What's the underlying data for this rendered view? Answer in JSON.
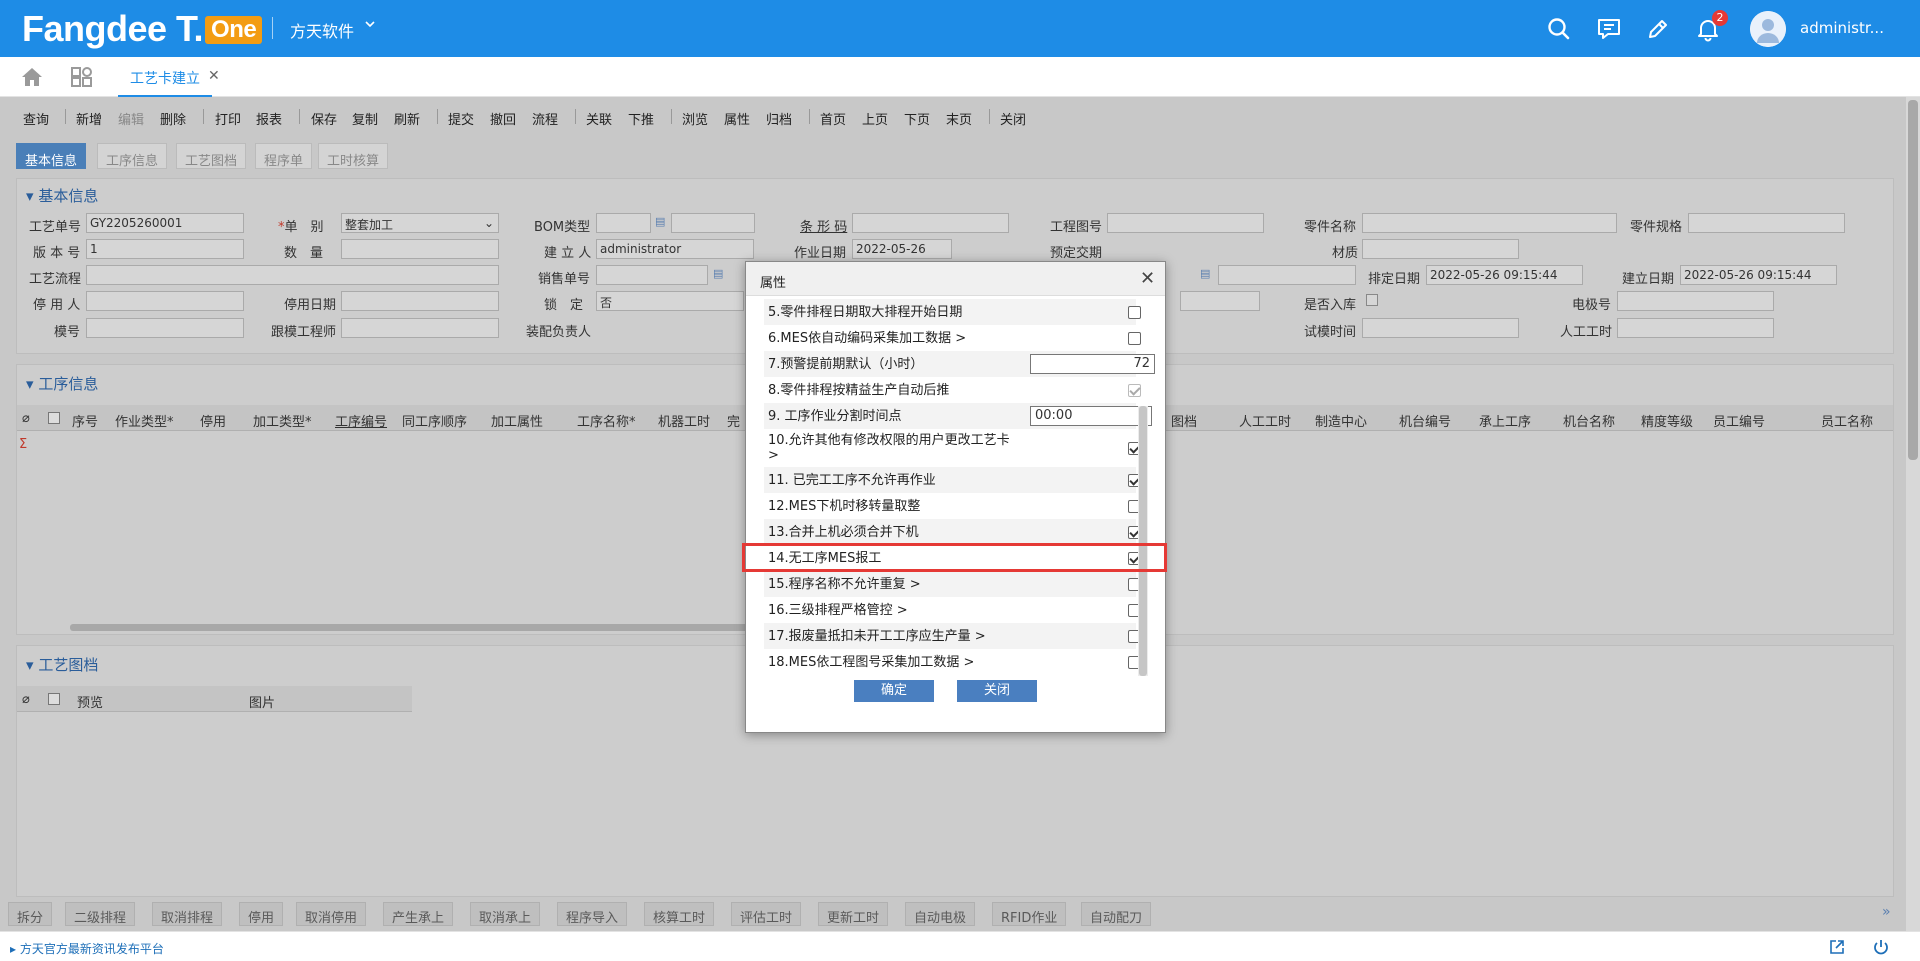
{
  "header": {
    "logo": "Fangdee T.",
    "logo_badge": "One",
    "company": "方天软件",
    "username": "administr...",
    "notification_count": "2"
  },
  "tabs": {
    "active": "工艺卡建立"
  },
  "toolbar": {
    "items": [
      "查询",
      "新增",
      "编辑",
      "删除",
      "打印",
      "报表",
      "保存",
      "复制",
      "刷新",
      "提交",
      "撤回",
      "流程",
      "关联",
      "下推",
      "浏览",
      "属性",
      "归档",
      "首页",
      "上页",
      "下页",
      "末页",
      "关闭"
    ]
  },
  "subtabs": [
    "基本信息",
    "工序信息",
    "工艺图档",
    "程序单",
    "工时核算"
  ],
  "basic": {
    "title": "基本信息",
    "labels": {
      "process_no": "工艺单号",
      "doc_type_star": "*",
      "doc_type": "单　别",
      "bom_type": "BOM类型",
      "barcode": "条 形 码",
      "drawing_no": "工程图号",
      "part_name": "零件名称",
      "part_spec": "零件规格",
      "version": "版 本 号",
      "quantity": "数　量",
      "creator": "建 立 人",
      "work_date": "作业日期",
      "due_date": "预定交期",
      "material": "材质",
      "route": "工艺流程",
      "sales_no": "销售单号",
      "schedule_date": "排定日期",
      "create_date": "建立日期",
      "disabled_by": "停 用 人",
      "disabled_date": "停用日期",
      "lock": "锁　定",
      "in_stock": "是否入库",
      "electrode_no": "电极号",
      "mold_no": "模号",
      "mold_engineer": "跟模工程师",
      "assembler": "装配负责人",
      "trial_time": "试模时间",
      "labor_hours": "人工工时"
    },
    "values": {
      "process_no": "GY2205260001",
      "doc_type": "整套加工",
      "version": "1",
      "creator": "administrator",
      "work_date": "2022-05-26",
      "schedule_date": "2022-05-26 09:15:44",
      "create_date": "2022-05-26 09:15:44",
      "lock": "否"
    }
  },
  "process_info": {
    "title": "工序信息",
    "columns": [
      "序号",
      "作业类型*",
      "停用",
      "加工类型*",
      "工序编号",
      "同工序顺序",
      "加工属性",
      "工序名称*",
      "机器工时",
      "完",
      "图档",
      "人工工时",
      "制造中心",
      "机台编号",
      "承上工序",
      "机台名称",
      "精度等级",
      "员工编号",
      "员工名称"
    ],
    "sum_symbol": "Σ"
  },
  "drawings": {
    "title": "工艺图档",
    "columns": [
      "预览",
      "图片"
    ]
  },
  "bottom_buttons": [
    "拆分",
    "二级排程",
    "取消排程",
    "停用",
    "取消停用",
    "产生承上",
    "取消承上",
    "程序导入",
    "核算工时",
    "评估工时",
    "更新工时",
    "自动电极",
    "RFID作业",
    "自动配刀"
  ],
  "footer": {
    "link": "方天官方最新资讯发布平台"
  },
  "modal": {
    "title": "属性",
    "rows": [
      {
        "label": "5.零件排程日期取大排程开始日期",
        "type": "checkbox",
        "checked": false
      },
      {
        "label": "6.MES依自动编码采集加工数据 >",
        "type": "checkbox",
        "checked": false
      },
      {
        "label": "7.预警提前期默认（小时）",
        "type": "number",
        "value": "72"
      },
      {
        "label": "8.零件排程按精益生产自动后推",
        "type": "checkbox",
        "checked": true,
        "disabled": true
      },
      {
        "label": "9. 工序作业分割时间点",
        "type": "text",
        "value": "00:00"
      },
      {
        "label": "10.允许其他有修改权限的用户更改工艺卡 >",
        "type": "checkbox",
        "checked": true
      },
      {
        "label": "11. 已完工工序不允许再作业",
        "type": "checkbox",
        "checked": true
      },
      {
        "label": "12.MES下机时移转量取整",
        "type": "checkbox",
        "checked": false
      },
      {
        "label": "13.合并上机必须合并下机",
        "type": "checkbox",
        "checked": true
      },
      {
        "label": "14.无工序MES报工",
        "type": "checkbox",
        "checked": true
      },
      {
        "label": "15.程序名称不允许重复 >",
        "type": "checkbox",
        "checked": false
      },
      {
        "label": "16.三级排程严格管控 >",
        "type": "checkbox",
        "checked": false
      },
      {
        "label": "17.报废量抵扣未开工工序应生产量 >",
        "type": "checkbox",
        "checked": false
      },
      {
        "label": "18.MES依工程图号采集加工数据 >",
        "type": "checkbox",
        "checked": false
      }
    ],
    "confirm": "确定",
    "close": "关闭"
  }
}
